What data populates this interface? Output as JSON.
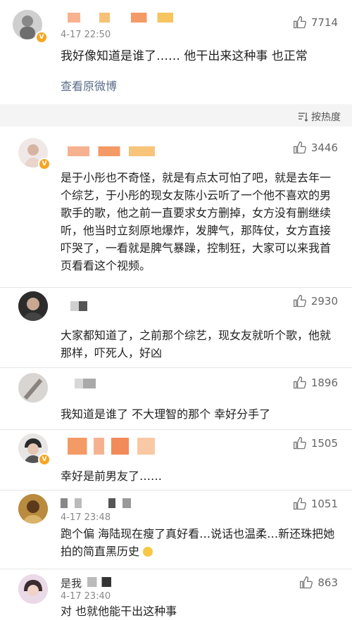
{
  "main_comment": {
    "time": "4-17 22:50",
    "likes": "7714",
    "text": "我好像知道是谁了…… 他干出来这种事 也正常",
    "view_original": "查看原微博"
  },
  "sort": {
    "label": "按热度"
  },
  "comments": [
    {
      "likes": "3446",
      "text": "是于小彤也不奇怪，就是有点太可怕了吧，就是去年一个综艺，于小彤的现女友陈小云听了一个他不喜欢的男歌手的歌，他之前一直要求女方删掉，女方没有删继续听，他当时立刻原地爆炸，发脾气，那阵仗，女方直接吓哭了，一看就是脾气暴躁，控制狂，大家可以来我首页看看这个视频。"
    },
    {
      "likes": "2930",
      "text": "大家都知道了，之前那个综艺，现女友就听个歌，他就那样，吓死人，好凶"
    },
    {
      "likes": "1896",
      "text": "我知道是谁了 不大理智的那个 幸好分手了"
    },
    {
      "likes": "1505",
      "text": "幸好是前男友了……"
    },
    {
      "time": "4-17 23:48",
      "likes": "1051",
      "text": "跑个偏 海陆现在瘦了真好看…说话也温柔…新还珠把她拍的简直黑历史"
    },
    {
      "name": "是我",
      "time": "4-17 23:40",
      "likes": "863",
      "text": "对 也就他能干出这种事"
    }
  ],
  "colors": {
    "accent": "#f5a623",
    "link": "#5b6e8a",
    "background": "#f7f7f7"
  },
  "icons": [
    "thumbs-up-icon",
    "sort-icon",
    "verified-badge-icon",
    "laugh-cry-emoji"
  ]
}
